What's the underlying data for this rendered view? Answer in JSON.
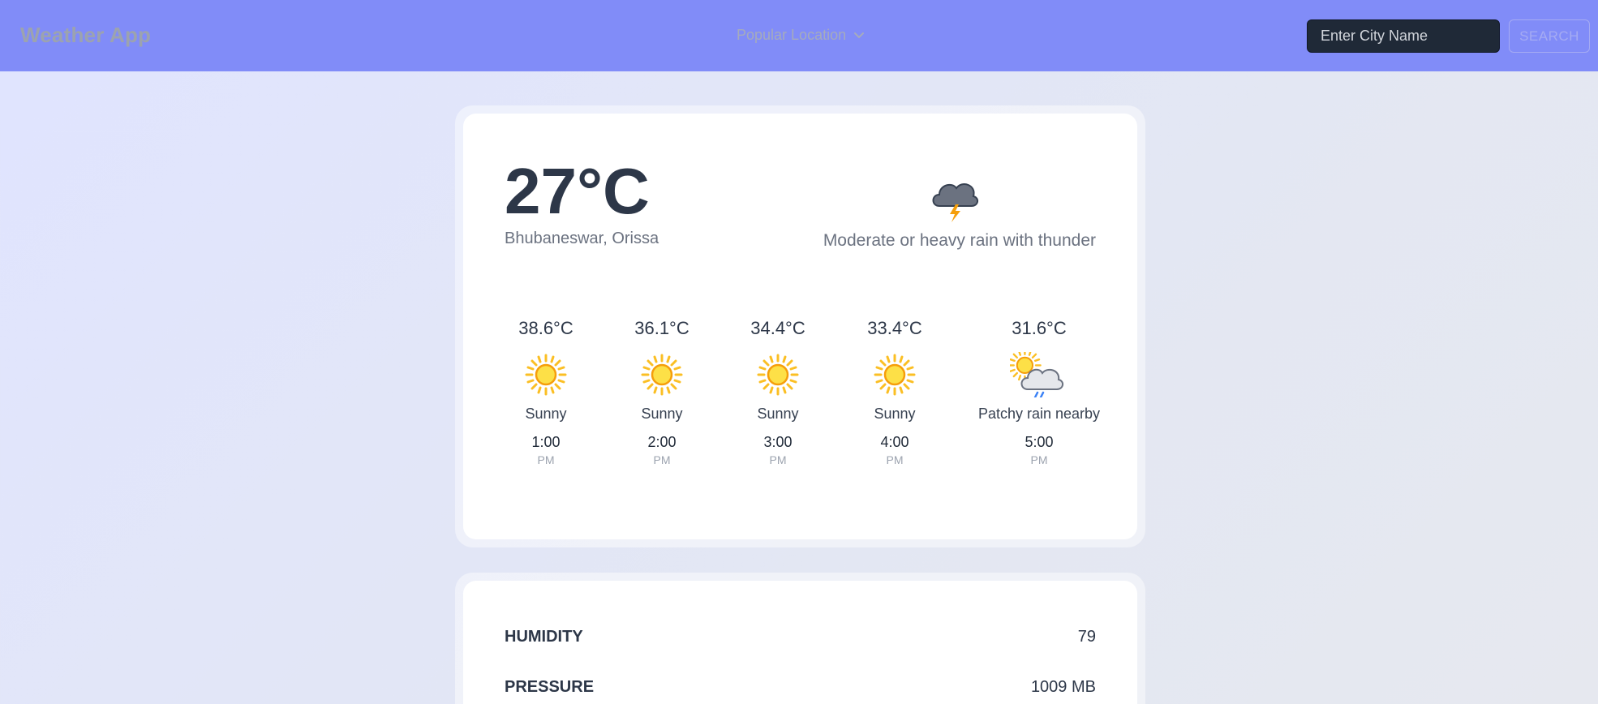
{
  "navbar": {
    "brand": "Weather App",
    "popular_label": "Popular Location",
    "search_placeholder": "Enter City Name",
    "search_button": "SEARCH"
  },
  "current": {
    "temperature": "27°C",
    "location": "Bhubaneswar, Orissa",
    "condition": "Moderate or heavy rain with thunder",
    "icon": "thunder-cloud-icon"
  },
  "forecast": [
    {
      "temp": "38.6°C",
      "condition": "Sunny",
      "time": "1:00",
      "ampm": "PM",
      "icon": "sun-icon"
    },
    {
      "temp": "36.1°C",
      "condition": "Sunny",
      "time": "2:00",
      "ampm": "PM",
      "icon": "sun-icon"
    },
    {
      "temp": "34.4°C",
      "condition": "Sunny",
      "time": "3:00",
      "ampm": "PM",
      "icon": "sun-icon"
    },
    {
      "temp": "33.4°C",
      "condition": "Sunny",
      "time": "4:00",
      "ampm": "PM",
      "icon": "sun-icon"
    },
    {
      "temp": "31.6°C",
      "condition": "Patchy rain nearby",
      "time": "5:00",
      "ampm": "PM",
      "icon": "sun-cloud-rain-icon"
    }
  ],
  "stats": [
    {
      "label": "HUMIDITY",
      "value": "79"
    },
    {
      "label": "PRESSURE",
      "value": "1009 MB"
    }
  ],
  "colors": {
    "navbar": "#818cf8",
    "input_bg": "#1f2937",
    "text_dark": "#2d3748",
    "text_muted": "#6b7280",
    "sun": "#fbbf24"
  }
}
